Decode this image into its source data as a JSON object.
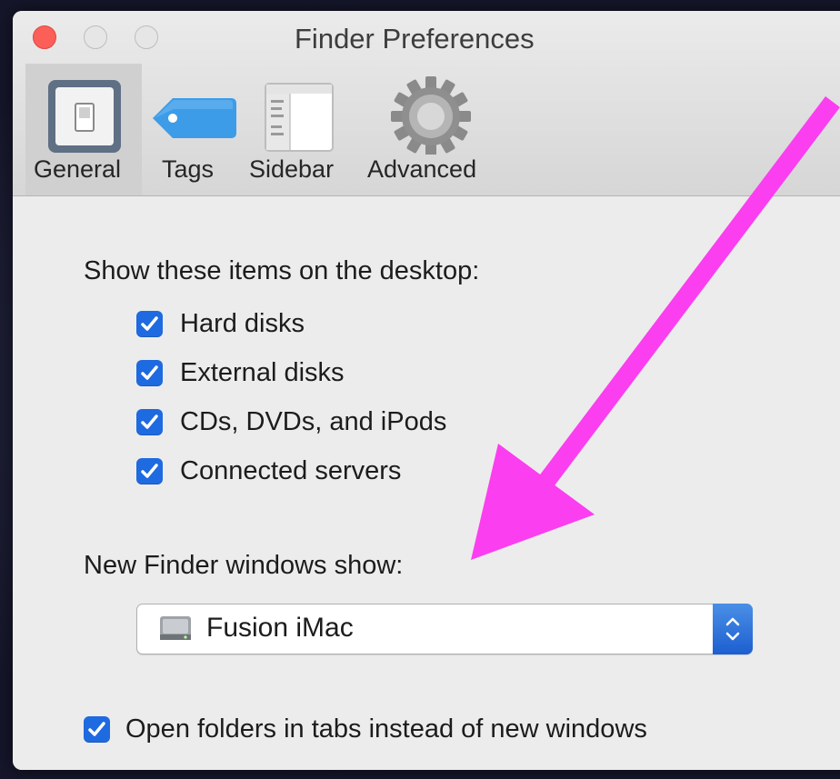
{
  "window": {
    "title": "Finder Preferences"
  },
  "toolbar": {
    "items": [
      {
        "label": "General",
        "icon": "general-switch-icon",
        "selected": true
      },
      {
        "label": "Tags",
        "icon": "tag-icon",
        "selected": false
      },
      {
        "label": "Sidebar",
        "icon": "sidebar-icon",
        "selected": false
      },
      {
        "label": "Advanced",
        "icon": "gear-icon",
        "selected": false
      }
    ]
  },
  "general": {
    "desktop_heading": "Show these items on the desktop:",
    "desktop_items": [
      {
        "label": "Hard disks",
        "checked": true
      },
      {
        "label": "External disks",
        "checked": true
      },
      {
        "label": "CDs, DVDs, and iPods",
        "checked": true
      },
      {
        "label": "Connected servers",
        "checked": true
      }
    ],
    "new_window_heading": "New Finder windows show:",
    "new_window_selection": {
      "label": "Fusion iMac",
      "icon": "hard-disk-icon"
    },
    "open_in_tabs": {
      "label": "Open folders in tabs instead of new windows",
      "checked": true
    }
  },
  "colors": {
    "checkbox": "#1e6ae0",
    "annotation_arrow": "#fb3ef0"
  }
}
